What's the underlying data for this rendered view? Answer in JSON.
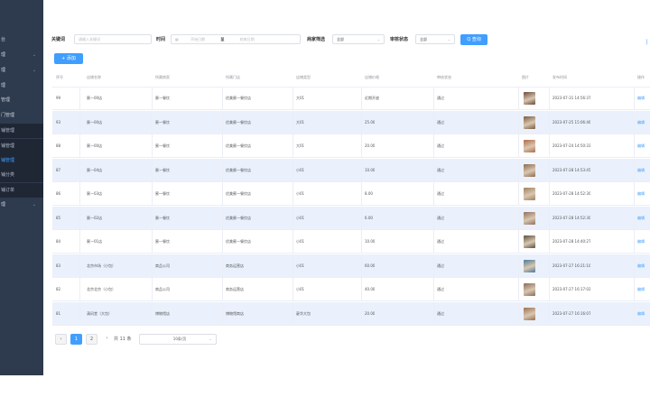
{
  "sidebar": {
    "items": [
      {
        "label": "台",
        "kind": "top"
      },
      {
        "label": "理",
        "kind": "top",
        "caret": "⌄"
      },
      {
        "label": "理",
        "kind": "top",
        "caret": "⌄"
      },
      {
        "label": "理",
        "kind": "top"
      },
      {
        "label": "管理",
        "kind": "top"
      },
      {
        "label": "门管理",
        "kind": "top"
      },
      {
        "label": "铺管理",
        "kind": "sub"
      },
      {
        "label": "铺管理",
        "kind": "sub"
      },
      {
        "label": "铺管理",
        "kind": "active"
      },
      {
        "label": "铺分类",
        "kind": "sub"
      },
      {
        "label": "铺订单",
        "kind": "sub"
      },
      {
        "label": "理",
        "kind": "top",
        "caret": "⌄"
      }
    ]
  },
  "filters": {
    "keyword_label": "关键词",
    "keyword_placeholder": "请输入关键词",
    "time_label": "时间",
    "start_placeholder": "开始日期",
    "range_sep": "至",
    "end_placeholder": "结束日期",
    "shop_label": "商家筛选",
    "shop_value": "全部",
    "audit_label": "审核状态",
    "audit_value": "全部",
    "search_button": "Q 查询"
  },
  "toolbar": {
    "add_button": "+ 添加"
  },
  "table": {
    "headers": [
      "序号",
      "店铺名称",
      "所属商家",
      "所属门店",
      "店铺类型",
      "店铺价格",
      "审核状态",
      "图片",
      "发布时间",
      "操作"
    ],
    "rows": [
      {
        "id": "99",
        "name": "蜜一00店",
        "merchant": "蜜一餐饮",
        "store": "优美蜜一餐饮店",
        "type": "大01",
        "price": "近期开放",
        "status": "通过",
        "img": "p1",
        "time": "2023-07-31 14:56:37",
        "action": "编辑"
      },
      {
        "id": "93",
        "name": "蜜一00店",
        "merchant": "蜜一餐饮",
        "store": "优美蜜一餐饮店",
        "type": "大01",
        "price": "25.00",
        "status": "通过",
        "img": "p2",
        "time": "2023-07-25 15:06:46",
        "action": "编辑"
      },
      {
        "id": "88",
        "name": "蜜一00店",
        "merchant": "蜜一餐饮",
        "store": "优美蜜一餐饮店",
        "type": "大01",
        "price": "20.00",
        "status": "通过",
        "img": "p3",
        "time": "2023-07-24 14:50:33",
        "action": "编辑"
      },
      {
        "id": "87",
        "name": "蜜一04店",
        "merchant": "蜜一餐饮",
        "store": "优美蜜一餐饮店",
        "type": "小01",
        "price": "10.00",
        "status": "通过",
        "img": "p4",
        "time": "2023-07-28 14:53:45",
        "action": "编辑"
      },
      {
        "id": "86",
        "name": "蜜一03店",
        "merchant": "蜜一餐饮",
        "store": "优美蜜一餐饮店",
        "type": "小01",
        "price": "8.00",
        "status": "通过",
        "img": "p5",
        "time": "2023-07-28 14:52:30",
        "action": "编辑"
      },
      {
        "id": "85",
        "name": "蜜一02店",
        "merchant": "蜜一餐饮",
        "store": "优美蜜一餐饮店",
        "type": "小01",
        "price": "6.00",
        "status": "通过",
        "img": "p6",
        "time": "2023-07-28 14:52:30",
        "action": "编辑"
      },
      {
        "id": "84",
        "name": "蜜一01店",
        "merchant": "蜜一餐饮",
        "store": "优美蜜一餐饮店",
        "type": "小01",
        "price": "10.00",
        "status": "通过",
        "img": "p7",
        "time": "2023-07-28 14:40:27",
        "action": "编辑"
      },
      {
        "id": "83",
        "name": "北京市场（小包）",
        "merchant": "商品公司",
        "store": "商务运营店",
        "type": "小01",
        "price": "60.00",
        "status": "通过",
        "img": "p8",
        "time": "2023-07-27 16:21:10",
        "action": "编辑"
      },
      {
        "id": "82",
        "name": "北京北京（小包）",
        "merchant": "商品公司",
        "store": "商务运营店",
        "type": "小01",
        "price": "40.00",
        "status": "通过",
        "img": "p9",
        "time": "2023-07-27 16:17:02",
        "action": "编辑"
      },
      {
        "id": "81",
        "name": "清风堂（大包）",
        "merchant": "博物馆店",
        "store": "博物馆商店",
        "type": "豪华大包",
        "price": "20.00",
        "status": "通过",
        "img": "p10",
        "time": "2023-07-27 16:16:07",
        "action": "编辑"
      }
    ]
  },
  "pagination": {
    "prev": "‹",
    "pages": [
      "1",
      "2"
    ],
    "next": "›",
    "total": "共 11 条",
    "page_size": "10条/页"
  },
  "colors": {
    "accent": "#409eff",
    "sidebar": "#2e3a4d",
    "row_alt": "#eaf1fc"
  },
  "icons": {
    "calendar": "calendar-icon",
    "search": "search-icon",
    "dropdown": "chevron-down-icon"
  }
}
